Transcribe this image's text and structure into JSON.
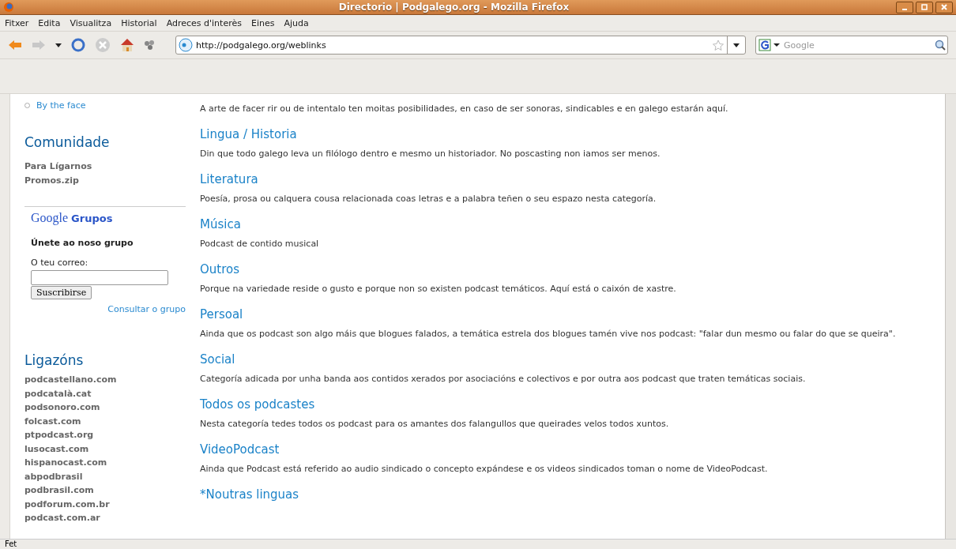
{
  "window": {
    "title": "Directorio | Podgalego.org - Mozilla Firefox"
  },
  "menu": [
    "Fitxer",
    "Edita",
    "Visualitza",
    "Historial",
    "Adreces d'interès",
    "Eines",
    "Ajuda"
  ],
  "address": {
    "value": "http://podgalego.org/weblinks"
  },
  "search": {
    "placeholder": "Google"
  },
  "sidebar": {
    "top_link": "By the face",
    "community": {
      "title": "Comunidade",
      "links": [
        "Para Lígarnos",
        "Promos.zip"
      ]
    },
    "groups": {
      "logo": "Google",
      "logo_suffix": "Grupos",
      "heading": "Únete ao noso grupo",
      "label": "O teu correo:",
      "button": "Suscribirse",
      "link": "Consultar o grupo"
    },
    "links_section": {
      "title": "Ligazóns",
      "links": [
        "podcastellano.com",
        "podcatalà.cat",
        "podsonoro.com",
        "folcast.com",
        "ptpodcast.org",
        "lusocast.com",
        "hispanocast.com",
        "abpodbrasil",
        "podbrasil.com",
        "podforum.com.br",
        "podcast.com.ar"
      ]
    }
  },
  "categories": [
    {
      "description": "A arte de facer rir ou de intentalo ten moitas posibilidades, en caso de ser sonoras, sindicables e en galego estarán aquí."
    },
    {
      "title": "Lingua / Historia",
      "description": "Din que todo galego leva un filólogo dentro e mesmo un historiador. No poscasting non iamos ser menos."
    },
    {
      "title": "Literatura",
      "description": "Poesía, prosa ou calquera cousa relacionada coas letras e a palabra teñen o seu espazo nesta categoría."
    },
    {
      "title": "Música",
      "description": "Podcast de contido musical"
    },
    {
      "title": "Outros",
      "description": "Porque na variedade reside o gusto e porque non so existen podcast temáticos. Aquí está o caixón de xastre."
    },
    {
      "title": "Persoal",
      "description": "Ainda que os podcast son algo máis que blogues falados, a temática estrela dos blogues tamén vive nos podcast: \"falar dun mesmo ou falar do que se queira\"."
    },
    {
      "title": "Social",
      "description": "Categoría adicada por unha banda aos contidos xerados por asociacións e colectivos e por outra aos podcast que traten temáticas sociais."
    },
    {
      "title": "Todos os podcastes",
      "description": "Nesta categoría tedes todos os podcast para os amantes dos falangullos que queirades velos todos xuntos."
    },
    {
      "title": "VideoPodcast",
      "description": "Ainda que Podcast está referido ao audio sindicado o concepto expándese e os videos sindicados toman o nome de VideoPodcast."
    },
    {
      "title": "*Noutras linguas"
    }
  ],
  "status_bar": "Fet"
}
